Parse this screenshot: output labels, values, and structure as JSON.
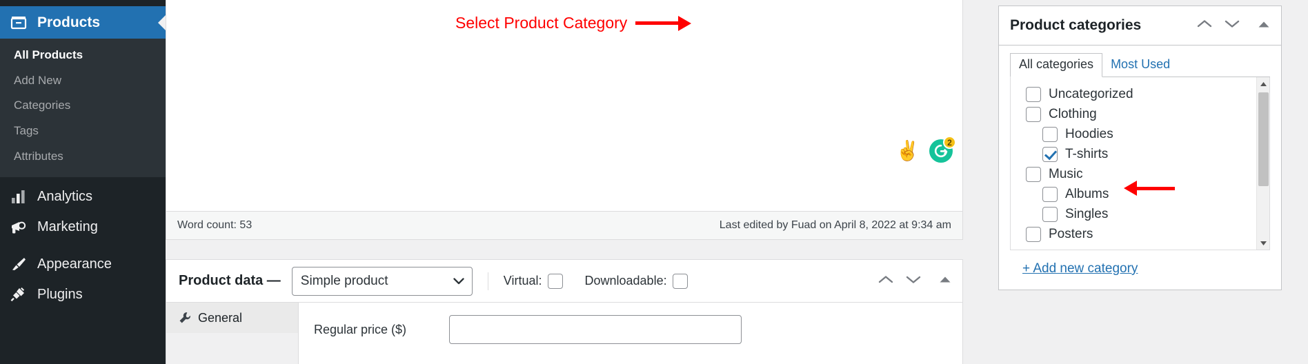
{
  "sidebar": {
    "current": {
      "label": "Products",
      "icon": "products-icon"
    },
    "submenu": [
      {
        "label": "All Products",
        "active": true
      },
      {
        "label": "Add New",
        "active": false
      },
      {
        "label": "Categories",
        "active": false
      },
      {
        "label": "Tags",
        "active": false
      },
      {
        "label": "Attributes",
        "active": false
      }
    ],
    "items": [
      {
        "label": "Analytics",
        "icon": "chart-bars-icon"
      },
      {
        "label": "Marketing",
        "icon": "megaphone-icon"
      },
      {
        "label": "Appearance",
        "icon": "paintbrush-icon"
      },
      {
        "label": "Plugins",
        "icon": "plug-icon"
      }
    ]
  },
  "editor": {
    "word_count": "Word count: 53",
    "last_edited": "Last edited by Fuad on April 8, 2022 at 9:34 am",
    "badges": {
      "hand_emoji": "✌",
      "grammarly_letter": "G",
      "grammarly_count": "2"
    }
  },
  "product_data": {
    "title": "Product data —",
    "type_selected": "Simple product",
    "virtual_label": "Virtual:",
    "virtual_checked": false,
    "downloadable_label": "Downloadable:",
    "downloadable_checked": false,
    "tabs": [
      {
        "label": "General",
        "icon": "wrench-icon",
        "active": true
      }
    ],
    "fields": [
      {
        "label": "Regular price ($)",
        "value": ""
      }
    ]
  },
  "categories_panel": {
    "title": "Product categories",
    "tabs": [
      {
        "label": "All categories",
        "active": true
      },
      {
        "label": "Most Used",
        "active": false
      }
    ],
    "items": [
      {
        "label": "Uncategorized",
        "level": 0,
        "checked": false
      },
      {
        "label": "Clothing",
        "level": 0,
        "checked": false
      },
      {
        "label": "Hoodies",
        "level": 1,
        "checked": false
      },
      {
        "label": "T-shirts",
        "level": 1,
        "checked": true
      },
      {
        "label": "Music",
        "level": 0,
        "checked": false
      },
      {
        "label": "Albums",
        "level": 1,
        "checked": false
      },
      {
        "label": "Singles",
        "level": 1,
        "checked": false
      },
      {
        "label": "Posters",
        "level": 0,
        "checked": false
      }
    ],
    "add_new_label": "+ Add new category"
  },
  "annotation": {
    "text": "Select Product Category",
    "color": "#ff0000"
  },
  "colors": {
    "admin_blue": "#2271b1",
    "sidebar_dark": "#1d2327",
    "sidebar_submenu": "#2c3338",
    "link_blue": "#2271b1",
    "grammarly_green": "#15c39a",
    "badge_yellow": "#f5c116",
    "annotation_red": "#ff0000"
  }
}
